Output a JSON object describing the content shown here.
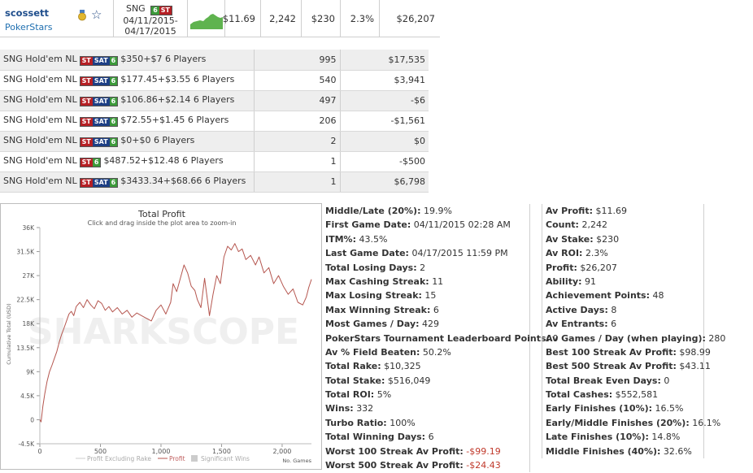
{
  "header": {
    "player_name": "scossett",
    "site": "PokerStars",
    "game_label": "SNG",
    "badge_st": "ST",
    "date_from": "04/11/2015-",
    "date_to": "04/17/2015",
    "av_profit": "$11.69",
    "count": "2,242",
    "av_stake": "$230",
    "av_roi": "2.3%",
    "profit": "$26,207"
  },
  "badges": {
    "st": "ST",
    "sat": "SAT",
    "six": "6"
  },
  "games": [
    {
      "type": "SNG Hold'em NL",
      "badges": [
        "ST",
        "SAT",
        "6"
      ],
      "desc": "$350+$7 6 Players",
      "count": "995",
      "profit": "$17,535",
      "negative": false
    },
    {
      "type": "SNG Hold'em NL",
      "badges": [
        "ST",
        "SAT",
        "6"
      ],
      "desc": "$177.45+$3.55 6 Players",
      "count": "540",
      "profit": "$3,941",
      "negative": false
    },
    {
      "type": "SNG Hold'em NL",
      "badges": [
        "ST",
        "SAT",
        "6"
      ],
      "desc": "$106.86+$2.14 6 Players",
      "count": "497",
      "profit": "-$6",
      "negative": true
    },
    {
      "type": "SNG Hold'em NL",
      "badges": [
        "ST",
        "SAT",
        "6"
      ],
      "desc": "$72.55+$1.45 6 Players",
      "count": "206",
      "profit": "-$1,561",
      "negative": true
    },
    {
      "type": "SNG Hold'em NL",
      "badges": [
        "ST",
        "SAT",
        "6"
      ],
      "desc": "$0+$0 6 Players",
      "count": "2",
      "profit": "$0",
      "negative": false
    },
    {
      "type": "SNG Hold'em NL",
      "badges": [
        "ST",
        "6"
      ],
      "desc": "$487.52+$12.48 6 Players",
      "count": "1",
      "profit": "-$500",
      "negative": true
    },
    {
      "type": "SNG Hold'em NL",
      "badges": [
        "ST",
        "SAT",
        "6"
      ],
      "desc": "$3433.34+$68.66 6 Players",
      "count": "1",
      "profit": "$6,798",
      "negative": false
    }
  ],
  "chart_data": {
    "type": "line",
    "title": "Total Profit",
    "subtitle": "Click and drag inside the plot area to zoom-in",
    "ylabel": "Cumulative Total (USD)",
    "xlabel": "No. Games",
    "watermark": "SHARKSCOPE",
    "x_ticks": [
      "0",
      "500",
      "1,000",
      "1,500",
      "2,000"
    ],
    "y_ticks": [
      "-4.5K",
      "0",
      "4.5K",
      "9K",
      "13.5K",
      "18K",
      "22.5K",
      "27K",
      "31.5K",
      "36K"
    ],
    "xlim": [
      0,
      2242
    ],
    "ylim": [
      -4500,
      36000
    ],
    "legend": [
      "Profit Excluding Rake",
      "Profit",
      "Significant Wins"
    ],
    "legend_placement": "bottom",
    "series": [
      {
        "name": "Profit",
        "color": "#b5564f",
        "x": [
          0,
          10,
          25,
          40,
          60,
          80,
          100,
          120,
          140,
          160,
          180,
          200,
          220,
          240,
          260,
          280,
          300,
          330,
          360,
          390,
          420,
          450,
          480,
          510,
          540,
          570,
          600,
          640,
          680,
          720,
          760,
          800,
          840,
          880,
          920,
          960,
          1000,
          1040,
          1080,
          1100,
          1130,
          1160,
          1190,
          1220,
          1250,
          1280,
          1300,
          1330,
          1360,
          1400,
          1430,
          1460,
          1490,
          1520,
          1550,
          1580,
          1610,
          1640,
          1670,
          1700,
          1740,
          1780,
          1810,
          1850,
          1890,
          1930,
          1970,
          2010,
          2050,
          2090,
          2130,
          2170,
          2200,
          2220,
          2242
        ],
        "y": [
          0,
          -400,
          2500,
          4800,
          7200,
          9000,
          10200,
          11500,
          12800,
          14500,
          16000,
          17200,
          18500,
          19800,
          20300,
          19500,
          21200,
          22000,
          21000,
          22500,
          21500,
          20800,
          22300,
          21800,
          20500,
          21200,
          20200,
          21000,
          19800,
          20500,
          19200,
          20000,
          19500,
          19000,
          18500,
          20500,
          21500,
          19800,
          22000,
          25500,
          24000,
          26500,
          29000,
          27500,
          25000,
          24200,
          22500,
          21000,
          26500,
          19500,
          23500,
          27000,
          25500,
          30500,
          32500,
          31800,
          33000,
          31500,
          32000,
          30000,
          30800,
          29000,
          30500,
          27500,
          28500,
          25500,
          27000,
          25000,
          23500,
          24500,
          22000,
          21500,
          23000,
          24800,
          26300
        ]
      }
    ]
  },
  "stats_mid": [
    {
      "label": "Middle/Late (20%):",
      "value": "19.9%",
      "negative": false
    },
    {
      "label": "First Game Date:",
      "value": "04/11/2015 02:28 AM",
      "negative": false
    },
    {
      "label": "ITM%:",
      "value": "43.5%",
      "negative": false
    },
    {
      "label": "Last Game Date:",
      "value": "04/17/2015 11:59 PM",
      "negative": false
    },
    {
      "label": "Total Losing Days:",
      "value": "2",
      "negative": false
    },
    {
      "label": "Max Cashing Streak:",
      "value": "11",
      "negative": false
    },
    {
      "label": "Max Losing Streak:",
      "value": "15",
      "negative": false
    },
    {
      "label": "Max Winning Streak:",
      "value": "6",
      "negative": false
    },
    {
      "label": "Most Games / Day:",
      "value": "429",
      "negative": false
    },
    {
      "label": "PokerStars Tournament Leaderboard Points:",
      "value": "0",
      "negative": false
    },
    {
      "label": "Av % Field Beaten:",
      "value": "50.2%",
      "negative": false
    },
    {
      "label": "Total Rake:",
      "value": "$10,325",
      "negative": false
    },
    {
      "label": "Total Stake:",
      "value": "$516,049",
      "negative": false
    },
    {
      "label": "Total ROI:",
      "value": "5%",
      "negative": false
    },
    {
      "label": "Wins:",
      "value": "332",
      "negative": false
    },
    {
      "label": "Turbo Ratio:",
      "value": "100%",
      "negative": false
    },
    {
      "label": "Total Winning Days:",
      "value": "6",
      "negative": false
    },
    {
      "label": "Worst 100 Streak Av Profit:",
      "value": "-$99.19",
      "negative": true
    },
    {
      "label": "Worst 500 Streak Av Profit:",
      "value": "-$24.43",
      "negative": true
    }
  ],
  "stats_right": [
    {
      "label": "Av Profit:",
      "value": "$11.69"
    },
    {
      "label": "Count:",
      "value": "2,242"
    },
    {
      "label": "Av Stake:",
      "value": "$230"
    },
    {
      "label": "Av ROI:",
      "value": "2.3%"
    },
    {
      "label": "Profit:",
      "value": "$26,207"
    },
    {
      "label": "Ability:",
      "value": "91"
    },
    {
      "label": "Achievement Points:",
      "value": "48"
    },
    {
      "label": "Active Days:",
      "value": "8"
    },
    {
      "label": "Av Entrants:",
      "value": "6"
    },
    {
      "label": "Av Games / Day (when playing):",
      "value": "280"
    },
    {
      "label": "Best 100 Streak Av Profit:",
      "value": "$98.99"
    },
    {
      "label": "Best 500 Streak Av Profit:",
      "value": "$43.11"
    },
    {
      "label": "Total Break Even Days:",
      "value": "0"
    },
    {
      "label": "Total Cashes:",
      "value": "$552,581"
    },
    {
      "label": "Early Finishes (10%):",
      "value": "16.5%"
    },
    {
      "label": "Early/Middle Finishes (20%):",
      "value": "16.1%"
    },
    {
      "label": "Late Finishes (10%):",
      "value": "14.8%"
    },
    {
      "label": "Middle Finishes (40%):",
      "value": "32.6%"
    }
  ]
}
